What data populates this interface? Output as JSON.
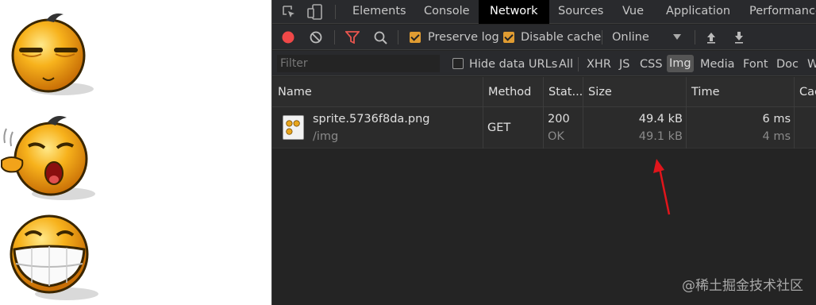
{
  "devtools": {
    "tabs": [
      "Elements",
      "Console",
      "Network",
      "Sources",
      "Vue",
      "Application",
      "Performance"
    ],
    "active_tab": "Network",
    "toolbar": {
      "preserve_log_label": "Preserve log",
      "preserve_log_checked": true,
      "disable_cache_label": "Disable cache",
      "disable_cache_checked": true,
      "throttle_value": "Online"
    },
    "filter": {
      "placeholder": "Filter",
      "hide_data_urls_label": "Hide data URLs",
      "hide_data_urls_checked": false,
      "types": [
        "All",
        "XHR",
        "JS",
        "CSS",
        "Img",
        "Media",
        "Font",
        "Doc",
        "W"
      ],
      "active_type": "Img"
    },
    "table": {
      "columns": [
        "Name",
        "Method",
        "Stat...",
        "Size",
        "Time",
        "Cac"
      ],
      "rows": [
        {
          "name": "sprite.5736f8da.png",
          "path": "/img",
          "method": "GET",
          "status": "200",
          "status_text": "OK",
          "size": "49.4 kB",
          "resource_size": "49.1 kB",
          "time": "6 ms",
          "latency": "4 ms"
        }
      ]
    }
  },
  "annotation_color": "#e0151b",
  "record_color": "#f04848",
  "filter_icon_color": "#e8554e",
  "checkbox_color": "#e09c32",
  "watermark": "@稀土掘金技术社区"
}
